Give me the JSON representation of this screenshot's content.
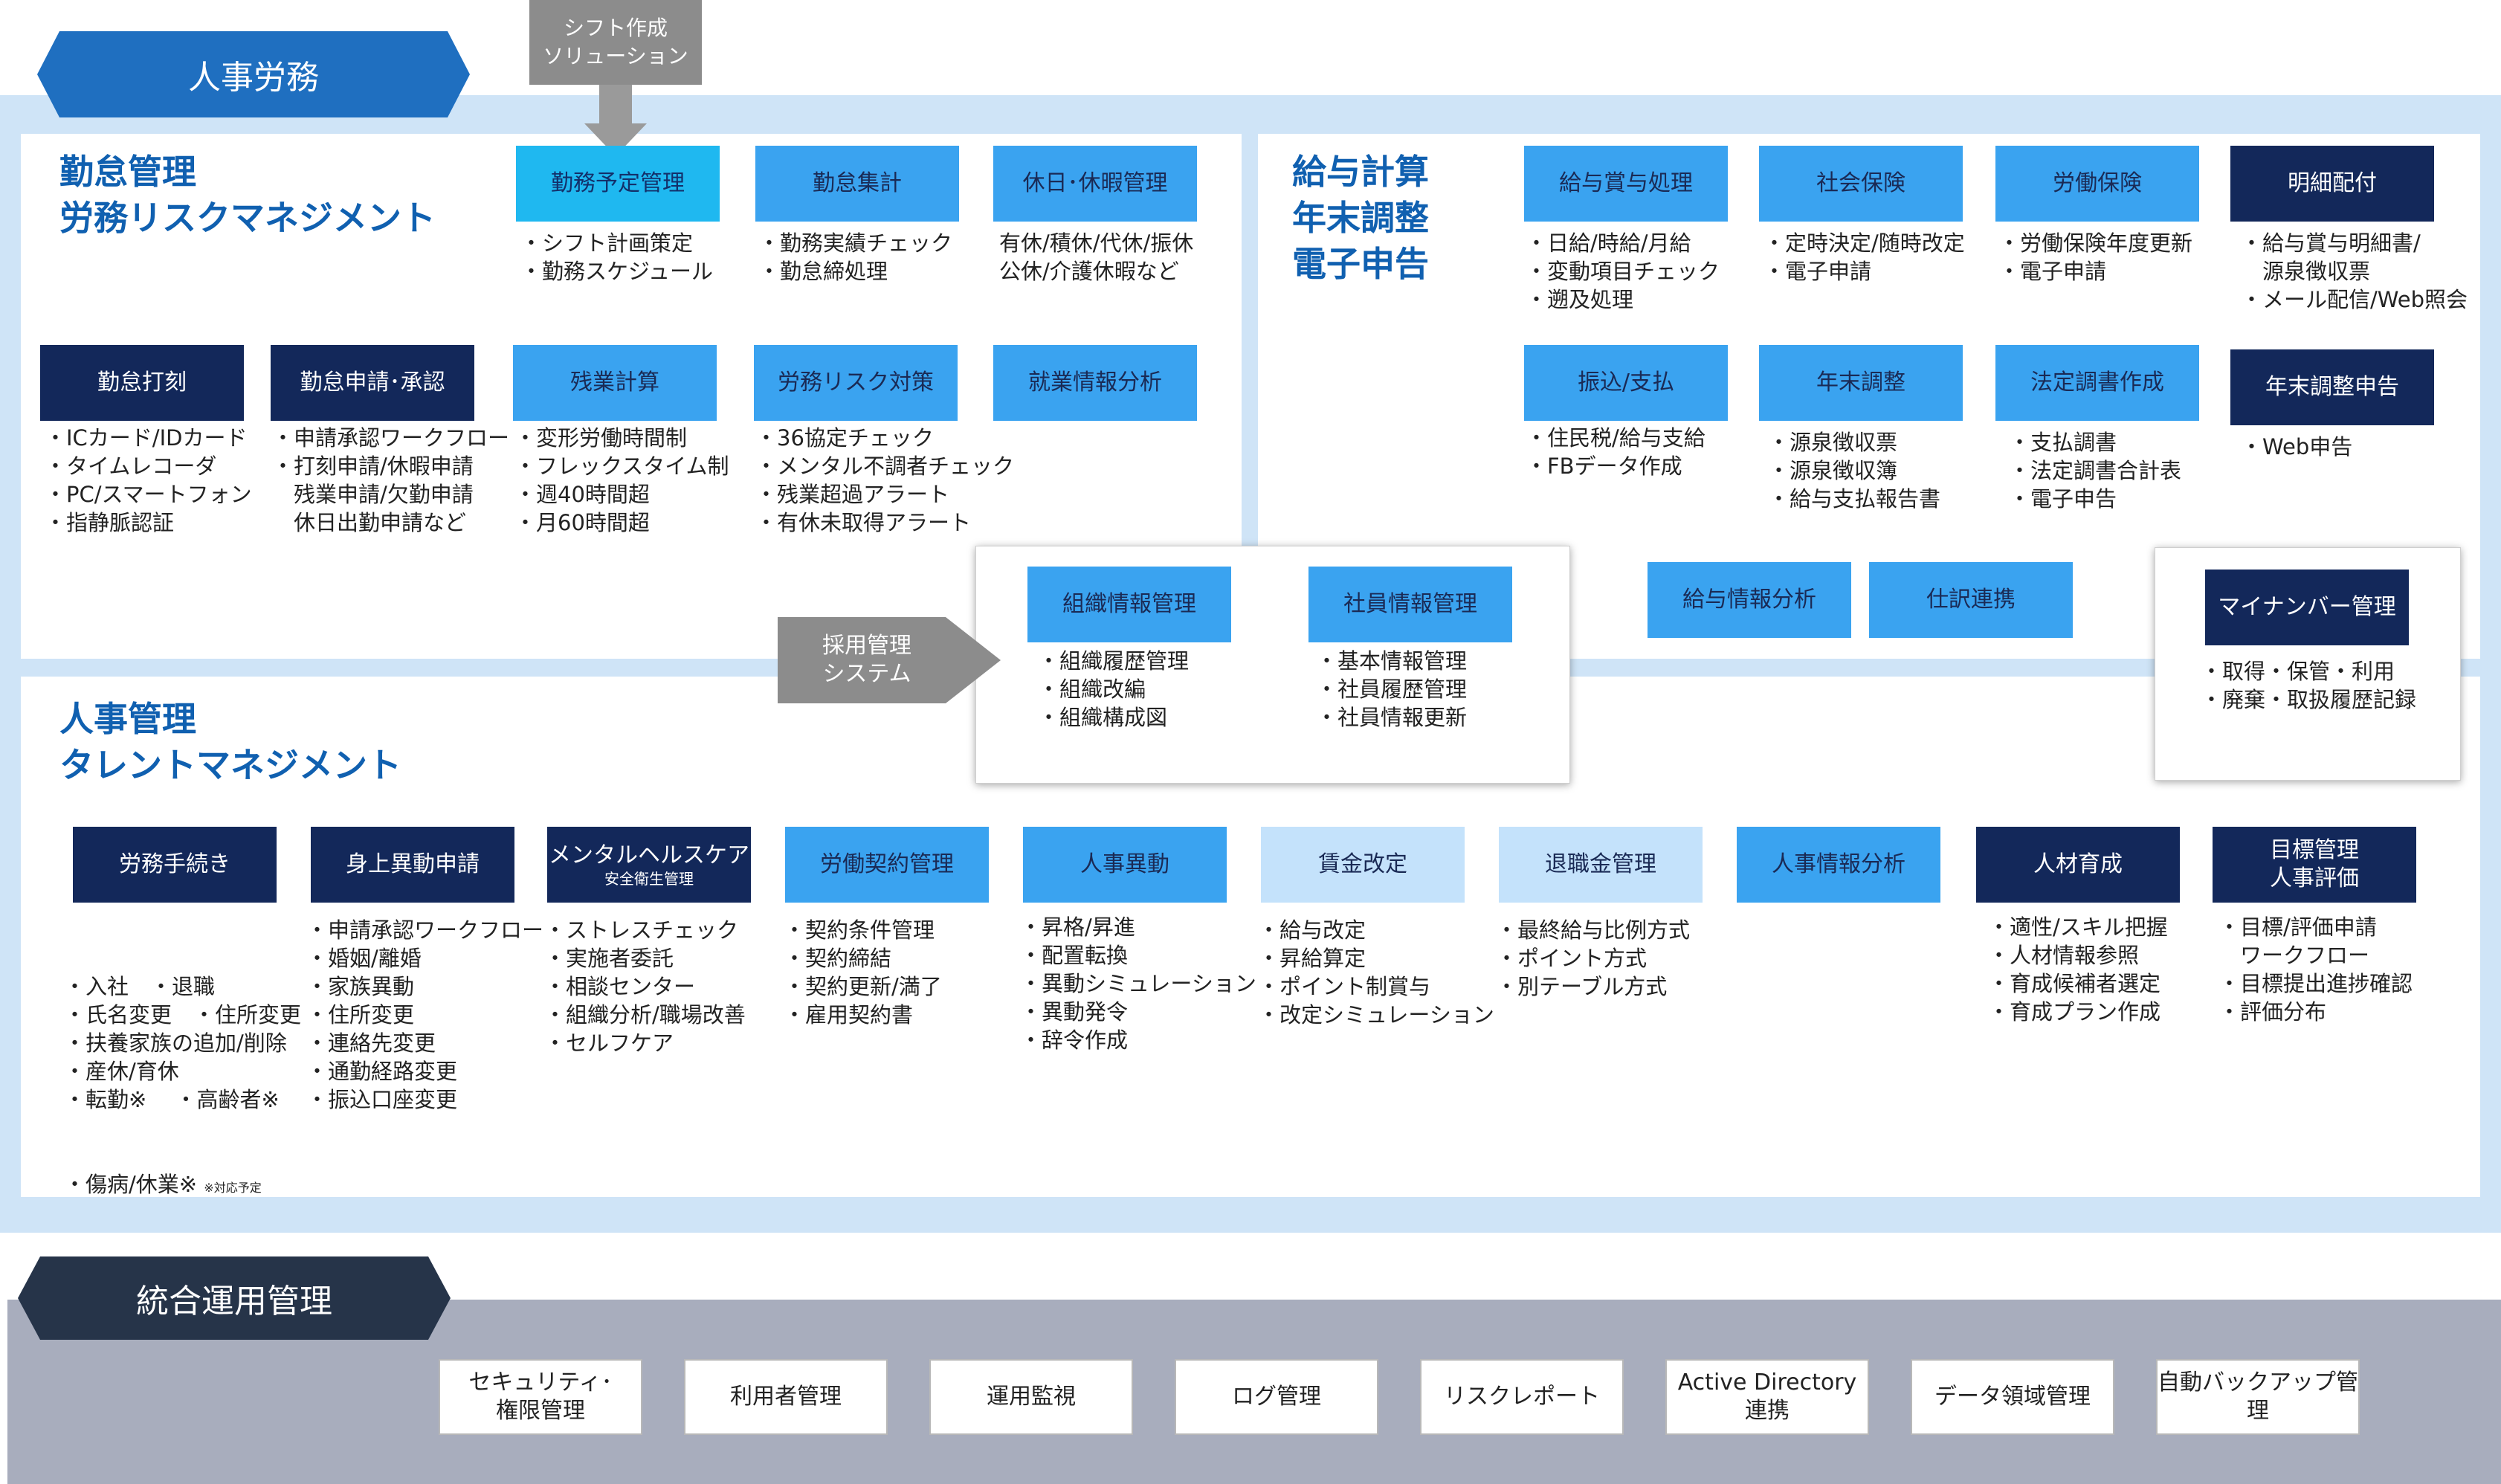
{
  "section_tags": {
    "hr_labor": "人事労務",
    "integrated": "統合運用管理"
  },
  "shift_solution": "シフト作成\nソリューション",
  "recruit_system": "採用管理\nシステム",
  "sections": {
    "attendance": "勤怠管理\n労務リスクマネジメント",
    "payroll": "給与計算\n年末調整\n電子申告",
    "hr": "人事管理\nタレントマネジメント"
  },
  "modules": {
    "schedule": {
      "label": "勤務予定管理",
      "items": [
        "・シフト計画策定",
        "・勤務スケジュール"
      ]
    },
    "attendance_total": {
      "label": "勤怠集計",
      "items": [
        "・勤務実績チェック",
        "・勤怠締処理"
      ]
    },
    "leave": {
      "label": "休日･休暇管理",
      "items": [
        "有休/積休/代休/振休",
        "公休/介護休暇など"
      ]
    },
    "clock": {
      "label": "勤怠打刻",
      "items": [
        "・ICカード/IDカード",
        "・タイムレコーダ",
        "・PC/スマートフォン",
        "・指静脈認証"
      ]
    },
    "request": {
      "label": "勤怠申請･承認",
      "items": [
        "・申請承認ワークフロー",
        "・打刻申請/休暇申請",
        "　残業申請/欠勤申請",
        "　休日出勤申請など"
      ]
    },
    "overtime": {
      "label": "残業計算",
      "items": [
        "・変形労働時間制",
        "・フレックスタイム制",
        "・週40時間超",
        "・月60時間超"
      ]
    },
    "risk": {
      "label": "労務リスク対策",
      "items": [
        "・36協定チェック",
        "・メンタル不調者チェック",
        "・残業超過アラート",
        "・有休未取得アラート"
      ]
    },
    "work_analysis": {
      "label": "就業情報分析",
      "items": []
    },
    "salary": {
      "label": "給与賞与処理",
      "items": [
        "・日給/時給/月給",
        "・変動項目チェック",
        "・遡及処理"
      ]
    },
    "social": {
      "label": "社会保険",
      "items": [
        "・定時決定/随時改定",
        "・電子申請"
      ]
    },
    "labor_ins": {
      "label": "労働保険",
      "items": [
        "・労働保険年度更新",
        "・電子申請"
      ]
    },
    "payslip": {
      "label": "明細配付",
      "items": [
        "・給与賞与明細書/",
        "　源泉徴収票",
        "・メール配信/Web照会"
      ]
    },
    "transfer": {
      "label": "振込/支払",
      "items": [
        "・住民税/給与支給",
        "・FBデータ作成"
      ]
    },
    "year_end": {
      "label": "年末調整",
      "items": [
        "・源泉徴収票",
        "・源泉徴収簿",
        "・給与支払報告書"
      ]
    },
    "legal": {
      "label": "法定調書作成",
      "items": [
        "・支払調書",
        "・法定調書合計表",
        "・電子申告"
      ]
    },
    "year_end_filing": {
      "label": "年末調整申告",
      "items": [
        "・Web申告"
      ]
    },
    "salary_analysis": {
      "label": "給与情報分析",
      "items": []
    },
    "journal": {
      "label": "仕訳連携",
      "items": []
    },
    "mynumber": {
      "label": "マイナンバー管理",
      "items": [
        "・取得・保管・利用",
        "・廃棄・取扱履歴記録"
      ]
    },
    "org": {
      "label": "組織情報管理",
      "items": [
        "・組織履歴管理",
        "・組織改編",
        "・組織構成図"
      ]
    },
    "employee": {
      "label": "社員情報管理",
      "items": [
        "・基本情報管理",
        "・社員履歴管理",
        "・社員情報更新"
      ]
    },
    "labor_proc": {
      "label": "労務手続き",
      "items": [
        "・入社　・退職",
        "・氏名変更　・住所変更",
        "・扶養家族の追加/削除",
        "・産休/育休",
        "・転勤※　 ・高齢者※"
      ]
    },
    "labor_proc_last": "・傷病/休業※ ",
    "labor_proc_note": "※対応予定",
    "personal": {
      "label": "身上異動申請",
      "items": [
        "・申請承認ワークフロー",
        "・婚姻/離婚",
        "・家族異動",
        "・住所変更",
        "・連絡先変更",
        "・通勤経路変更",
        "・振込口座変更"
      ]
    },
    "mental": {
      "label": "メンタルヘルスケア",
      "sub": "安全衛生管理",
      "items": [
        "・ストレスチェック",
        "・実施者委託",
        "・相談センター",
        "・組織分析/職場改善",
        "・セルフケア"
      ]
    },
    "contract": {
      "label": "労働契約管理",
      "items": [
        "・契約条件管理",
        "・契約締結",
        "・契約更新/満了",
        "・雇用契約書"
      ]
    },
    "transfer_hr": {
      "label": "人事異動",
      "items": [
        "・昇格/昇進",
        "・配置転換",
        "・異動シミュレーション",
        "・異動発令",
        "・辞令作成"
      ]
    },
    "wage": {
      "label": "賃金改定",
      "items": [
        "・給与改定",
        "・昇給算定",
        "・ポイント制賞与",
        "・改定シミュレーション"
      ]
    },
    "retire": {
      "label": "退職金管理",
      "items": [
        "・最終給与比例方式",
        "・ポイント方式",
        "・別テーブル方式"
      ]
    },
    "hr_analysis": {
      "label": "人事情報分析",
      "items": []
    },
    "talent": {
      "label": "人材育成",
      "items": [
        "・適性/スキル把握",
        "・人材情報参照",
        "・育成候補者選定",
        "・育成プラン作成"
      ]
    },
    "goal": {
      "label": "目標管理\n人事評価",
      "items": [
        "・目標/評価申請",
        "　ワークフロー",
        "・目標提出進捗確認",
        "・評価分布"
      ]
    }
  },
  "ops": [
    "セキュリティ･\n権限管理",
    "利用者管理",
    "運用監視",
    "ログ管理",
    "リスクレポート",
    "Active Directory\n連携",
    "データ領域管理",
    "自動バックアップ管理"
  ]
}
